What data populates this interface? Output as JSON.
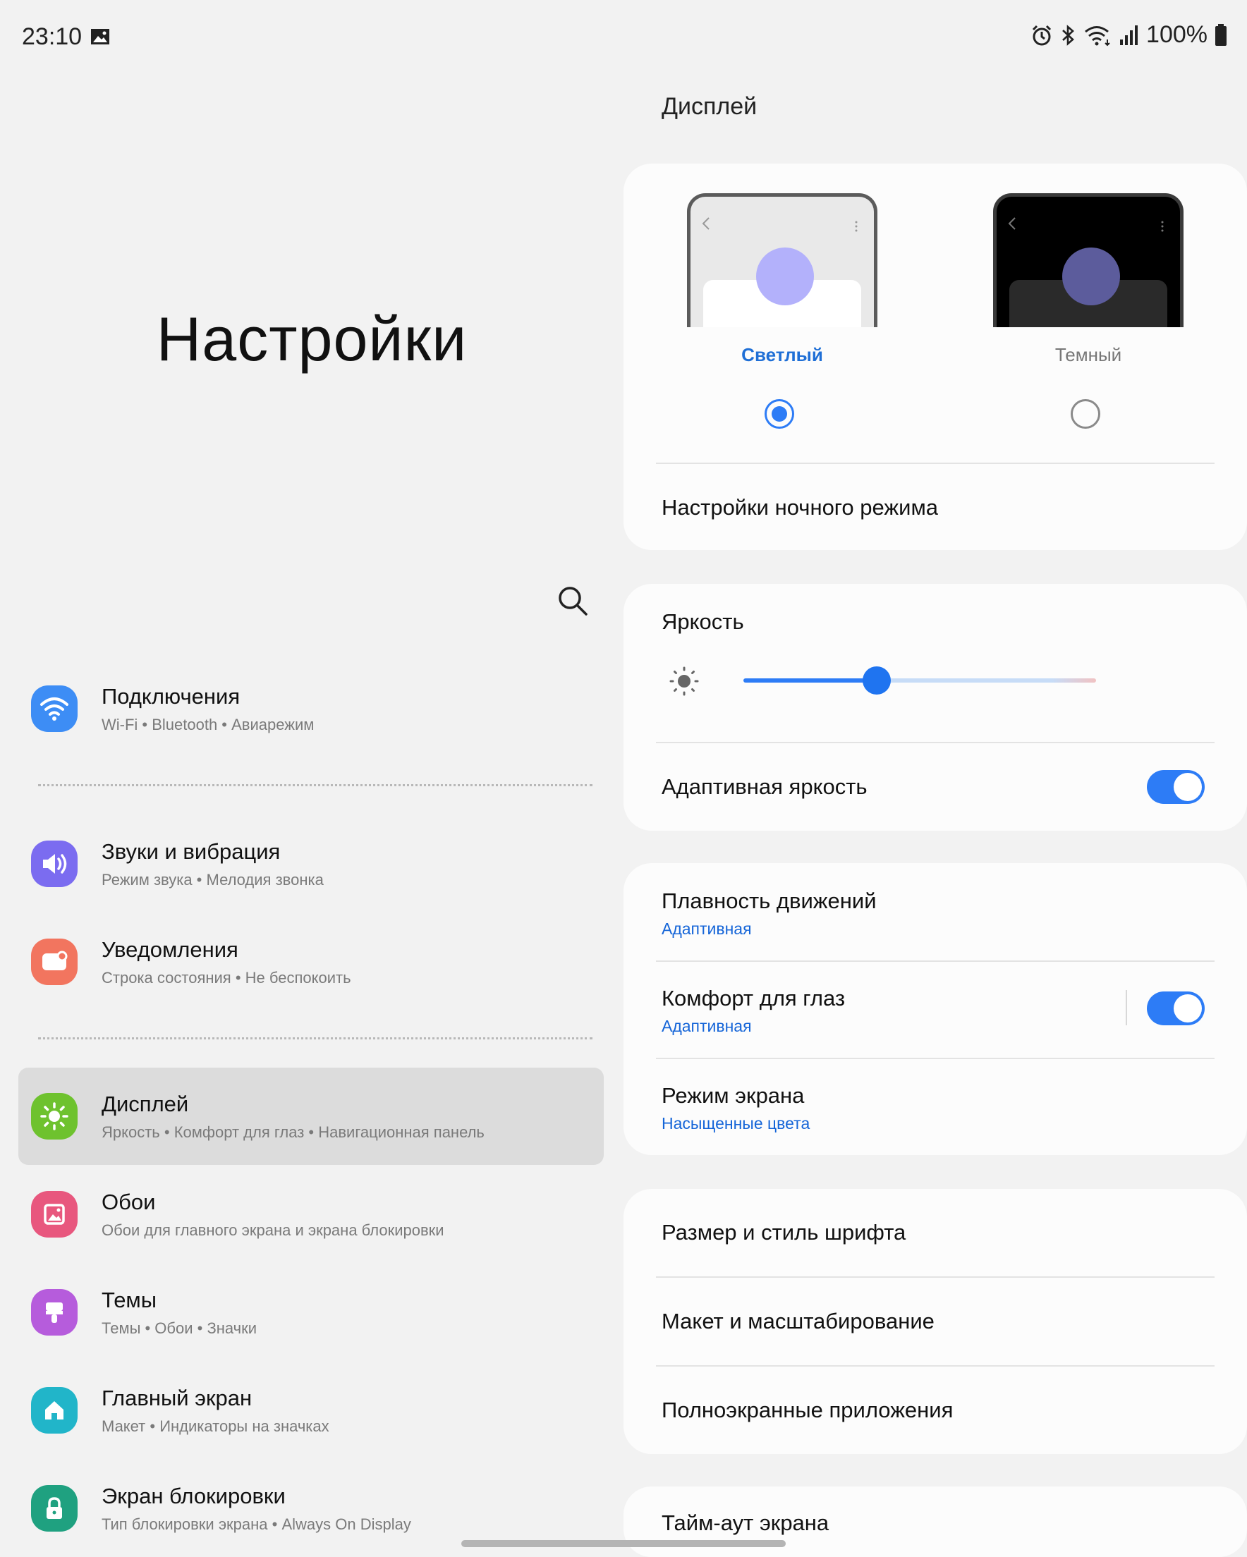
{
  "status_bar": {
    "time": "23:10",
    "battery": "100%",
    "icons": [
      "gallery-icon",
      "alarm-icon",
      "bluetooth-icon",
      "wifi-icon",
      "signal-icon",
      "battery-icon"
    ]
  },
  "left": {
    "title": "Настройки",
    "items": [
      {
        "title": "Подключения",
        "sub": "Wi-Fi  •  Bluetooth  •  Авиарежим",
        "icon": "wifi-icon",
        "color": "#3d8df5"
      },
      {
        "title": "Звуки и вибрация",
        "sub": "Режим звука  •  Мелодия звонка",
        "icon": "volume-icon",
        "color": "#7b6cf0"
      },
      {
        "title": "Уведомления",
        "sub": "Строка состояния  •  Не беспокоить",
        "icon": "notification-icon",
        "color": "#f2755f"
      },
      {
        "title": "Дисплей",
        "sub": "Яркость  •  Комфорт для глаз  •  Навигационная панель",
        "icon": "sun-icon",
        "color": "#6ec22e"
      },
      {
        "title": "Обои",
        "sub": "Обои для главного экрана и экрана блокировки",
        "icon": "wallpaper-icon",
        "color": "#e8577e"
      },
      {
        "title": "Темы",
        "sub": "Темы  •  Обои  •  Значки",
        "icon": "brush-icon",
        "color": "#b65cdc"
      },
      {
        "title": "Главный экран",
        "sub": "Макет  •  Индикаторы на значках",
        "icon": "home-icon",
        "color": "#21b5c9"
      },
      {
        "title": "Экран блокировки",
        "sub": "Тип блокировки экрана  •  Always On Display",
        "icon": "lock-icon",
        "color": "#1fa180"
      }
    ]
  },
  "right": {
    "section_title": "Дисплей",
    "theme": {
      "light_label": "Светлый",
      "dark_label": "Темный",
      "selected": "light",
      "night_settings": "Настройки ночного режима"
    },
    "brightness": {
      "label": "Яркость",
      "level": 0.3,
      "adaptive_label": "Адаптивная яркость",
      "adaptive_on": true
    },
    "motion": {
      "label": "Плавность движений",
      "value": "Адаптивная"
    },
    "eye_comfort": {
      "label": "Комфорт для глаз",
      "value": "Адаптивная",
      "on": true
    },
    "screen_mode": {
      "label": "Режим экрана",
      "value": "Насыщенные цвета"
    },
    "font": "Размер и стиль шрифта",
    "layout": "Макет и масштабирование",
    "fullscreen": "Полноэкранные приложения",
    "timeout": "Тайм-аут экрана"
  },
  "colors": {
    "accent": "#2d7cf6",
    "link_blue": "#1565d8",
    "light_label_blue": "#1f6fd6"
  }
}
